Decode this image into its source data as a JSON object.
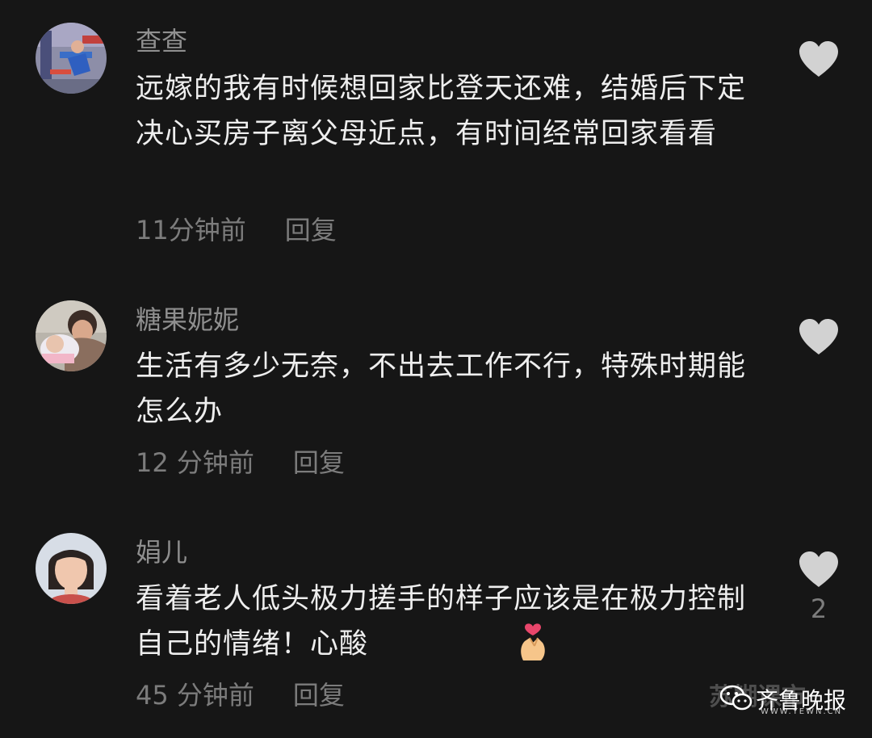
{
  "comments": [
    {
      "username": "查查",
      "text": "远嫁的我有时候想回家比登天还难，结婚后下定决心买房子离父母近点，有时间经常回家看看",
      "time": "11分钟前",
      "reply": "回复",
      "likes": ""
    },
    {
      "username": "糖果妮妮",
      "text": "生活有多少无奈，不出去工作不行，特殊时期能怎么办",
      "time": "12 分钟前",
      "reply": "回复",
      "likes": ""
    },
    {
      "username": "娟儿",
      "text": "看着老人低头极力搓手的样子应该是在极力控制自己的情绪！心酸",
      "time": "45 分钟前",
      "reply": "回复",
      "likes": "2",
      "emoji": "finger-heart-emoji"
    }
  ],
  "watermark": {
    "name": "齐鲁晚报",
    "url": "WWW.YEWN.CN",
    "background_text": "苏糊课市"
  },
  "colors": {
    "background": "#161616",
    "text": "#eeeeee",
    "secondary": "#7c7c7c",
    "icon": "#d2d2d2"
  }
}
